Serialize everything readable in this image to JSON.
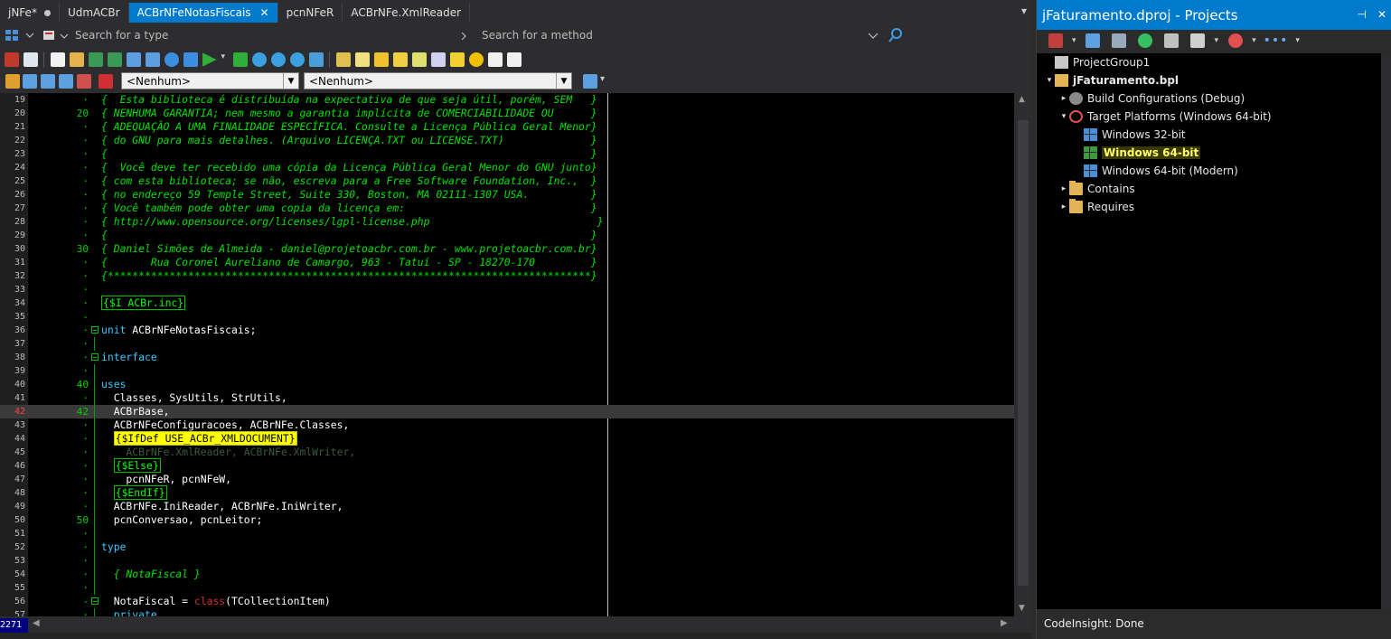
{
  "editor": {
    "tabs": [
      {
        "label": "jNFe*",
        "modified": true,
        "active": false
      },
      {
        "label": "UdmACBr",
        "active": false
      },
      {
        "label": "ACBrNFeNotasFiscais",
        "active": true
      },
      {
        "label": "pcnNFeR",
        "active": false
      },
      {
        "label": "ACBrNFe.XmlReader",
        "active": false
      }
    ],
    "search_type_placeholder": "Search for a type",
    "search_method_placeholder": "Search for a method",
    "combo1_value": "<Nenhum>",
    "combo2_value": "<Nenhum>",
    "status_position": "2271",
    "accent_color": "#007acc",
    "lines": [
      {
        "n": "19",
        "mark": "·",
        "text": "{  Esta biblioteca é distribuída na expectativa de que seja útil, porém, SEM   }",
        "style": "cm"
      },
      {
        "n": "20",
        "mark": "20",
        "text": "{ NENHUMA GARANTIA; nem mesmo a garantia implícita de COMERCIABILIDADE OU      }",
        "style": "cm"
      },
      {
        "n": "21",
        "mark": "·",
        "text": "{ ADEQUAÇÃO A UMA FINALIDADE ESPECÍFICA. Consulte a Licença Pública Geral Menor}",
        "style": "cm"
      },
      {
        "n": "22",
        "mark": "·",
        "text": "{ do GNU para mais detalhes. (Arquivo LICENÇA.TXT ou LICENSE.TXT)              }",
        "style": "cm"
      },
      {
        "n": "23",
        "mark": "·",
        "text": "{                                                                              }",
        "style": "cm"
      },
      {
        "n": "24",
        "mark": "·",
        "text": "{  Você deve ter recebido uma cópia da Licença Pública Geral Menor do GNU junto}",
        "style": "cm"
      },
      {
        "n": "25",
        "mark": "·",
        "text": "{ com esta biblioteca; se não, escreva para a Free Software Foundation, Inc.,  }",
        "style": "cm"
      },
      {
        "n": "26",
        "mark": "·",
        "text": "{ no endereço 59 Temple Street, Suite 330, Boston, MA 02111-1307 USA.          }",
        "style": "cm"
      },
      {
        "n": "27",
        "mark": "·",
        "text": "{ Você também pode obter uma copia da licença em:                              }",
        "style": "cm"
      },
      {
        "n": "28",
        "mark": "·",
        "text": "{ http://www.opensource.org/licenses/lgpl-license.php                           }",
        "style": "cm"
      },
      {
        "n": "29",
        "mark": "·",
        "text": "{                                                                              }",
        "style": "cm"
      },
      {
        "n": "30",
        "mark": "30",
        "text": "{ Daniel Simões de Almeida - daniel@projetoacbr.com.br - www.projetoacbr.com.br}",
        "style": "cm"
      },
      {
        "n": "31",
        "mark": "·",
        "text": "{       Rua Coronel Aureliano de Camargo, 963 - Tatuí - SP - 18270-170         }",
        "style": "cm"
      },
      {
        "n": "32",
        "mark": "·",
        "text": "{******************************************************************************}",
        "style": "cm"
      },
      {
        "n": "33",
        "mark": "·",
        "text": "",
        "style": "id"
      },
      {
        "n": "34",
        "mark": "·",
        "text": "{$I ACBr.inc}",
        "style": "dir"
      },
      {
        "n": "35",
        "mark": "-",
        "text": "",
        "style": "id"
      },
      {
        "n": "36",
        "mark": "·",
        "fold": true,
        "parts": [
          {
            "t": "unit ",
            "s": "kw"
          },
          {
            "t": "ACBrNFeNotasFiscais;",
            "s": "id"
          }
        ]
      },
      {
        "n": "37",
        "mark": "·",
        "vline": true,
        "text": "",
        "style": "id"
      },
      {
        "n": "38",
        "mark": "·",
        "fold": true,
        "parts": [
          {
            "t": "interface",
            "s": "kw"
          }
        ]
      },
      {
        "n": "39",
        "mark": "·",
        "vline": true,
        "text": "",
        "style": "id"
      },
      {
        "n": "40",
        "mark": "40",
        "parts": [
          {
            "t": "uses",
            "s": "kw"
          }
        ]
      },
      {
        "n": "41",
        "mark": "·",
        "text": "  Classes, SysUtils, StrUtils,",
        "style": "id"
      },
      {
        "n": "42",
        "mark": "42",
        "current": true,
        "text": "  ACBrBase,",
        "style": "id"
      },
      {
        "n": "43",
        "mark": "·",
        "text": "  ACBrNFeConfiguracoes, ACBrNFe.Classes,",
        "style": "id"
      },
      {
        "n": "44",
        "mark": "·",
        "indent": "  ",
        "text": "{$IfDef USE_ACBr_XMLDOCUMENT}",
        "style": "dir-y"
      },
      {
        "n": "45",
        "mark": "·",
        "text": "    ACBrNFe.XmlReader, ACBrNFe.XmlWriter,",
        "style": "dim"
      },
      {
        "n": "46",
        "mark": "·",
        "indent": "  ",
        "text": "{$Else}",
        "style": "dir"
      },
      {
        "n": "47",
        "mark": "·",
        "text": "    pcnNFeR, pcnNFeW,",
        "style": "id"
      },
      {
        "n": "48",
        "mark": "·",
        "indent": "  ",
        "text": "{$EndIf}",
        "style": "dir"
      },
      {
        "n": "49",
        "mark": "·",
        "text": "  ACBrNFe.IniReader, ACBrNFe.IniWriter,",
        "style": "id"
      },
      {
        "n": "50",
        "mark": "50",
        "text": "  pcnConversao, pcnLeitor;",
        "style": "id"
      },
      {
        "n": "51",
        "mark": "·",
        "text": "",
        "style": "id"
      },
      {
        "n": "52",
        "mark": "·",
        "parts": [
          {
            "t": "type",
            "s": "kw"
          }
        ]
      },
      {
        "n": "53",
        "mark": "·",
        "text": "",
        "style": "id"
      },
      {
        "n": "54",
        "mark": "·",
        "text": "  { NotaFiscal }",
        "style": "cm"
      },
      {
        "n": "55",
        "mark": "·",
        "text": "",
        "style": "id"
      },
      {
        "n": "56",
        "mark": "-",
        "fold": true,
        "parts": [
          {
            "t": "  NotaFiscal = ",
            "s": "id"
          },
          {
            "t": "class",
            "s": "cls"
          },
          {
            "t": "(TCollectionItem)",
            "s": "id"
          }
        ]
      },
      {
        "n": "57",
        "mark": "·",
        "text": "  private",
        "style": "kw"
      }
    ]
  },
  "projects": {
    "title": "jFaturamento.dproj - Projects",
    "status": "CodeInsight: Done",
    "tree": [
      {
        "label": "ProjectGroup1",
        "level": 0,
        "icon": "project-group-icon",
        "twisty": ""
      },
      {
        "label": "jFaturamento.bpl",
        "level": 0,
        "icon": "package-icon",
        "twisty": "▾",
        "bold": true
      },
      {
        "label": "Build Configurations (Debug)",
        "level": 1,
        "icon": "gears-icon",
        "twisty": "▸"
      },
      {
        "label": "Target Platforms (Windows 64-bit)",
        "level": 1,
        "icon": "target-icon",
        "twisty": "▾"
      },
      {
        "label": "Windows 32-bit",
        "level": 2,
        "icon": "windows-icon",
        "twisty": ""
      },
      {
        "label": "Windows 64-bit",
        "level": 2,
        "icon": "windows-icon",
        "twisty": "",
        "highlight": true
      },
      {
        "label": "Windows 64-bit (Modern)",
        "level": 2,
        "icon": "windows-icon",
        "twisty": ""
      },
      {
        "label": "Contains",
        "level": 1,
        "icon": "folder-icon",
        "twisty": "▸"
      },
      {
        "label": "Requires",
        "level": 1,
        "icon": "folder-icon",
        "twisty": "▸"
      }
    ]
  }
}
